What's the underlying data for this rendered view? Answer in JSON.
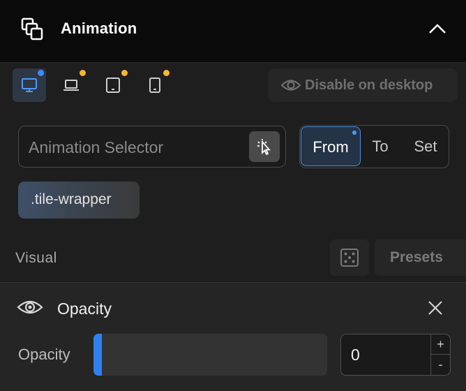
{
  "header": {
    "title": "Animation",
    "icon": "overlap-squares-icon"
  },
  "devices": [
    {
      "name": "desktop",
      "icon": "monitor-icon",
      "active": true,
      "dot_color": "#3b8cff"
    },
    {
      "name": "laptop",
      "icon": "laptop-icon",
      "active": false,
      "dot_color": "#f5b731"
    },
    {
      "name": "tablet",
      "icon": "tablet-icon",
      "active": false,
      "dot_color": "#f5b731"
    },
    {
      "name": "mobile",
      "icon": "phone-icon",
      "active": false,
      "dot_color": "#f5b731"
    }
  ],
  "disable_button": {
    "label": "Disable on desktop"
  },
  "selector": {
    "placeholder": "Animation Selector"
  },
  "mode_tabs": {
    "options": [
      "From",
      "To",
      "Set"
    ],
    "active": "From"
  },
  "chip": {
    "label": ".tile-wrapper"
  },
  "visual": {
    "label": "Visual",
    "presets_label": "Presets"
  },
  "opacity": {
    "title": "Opacity",
    "field_label": "Opacity",
    "value": "0",
    "step_up": "+",
    "step_down": "-",
    "level": 0
  },
  "colors": {
    "accent": "#2f80ed",
    "active_dot": "#3b8cff",
    "warn_dot": "#f5b731"
  }
}
